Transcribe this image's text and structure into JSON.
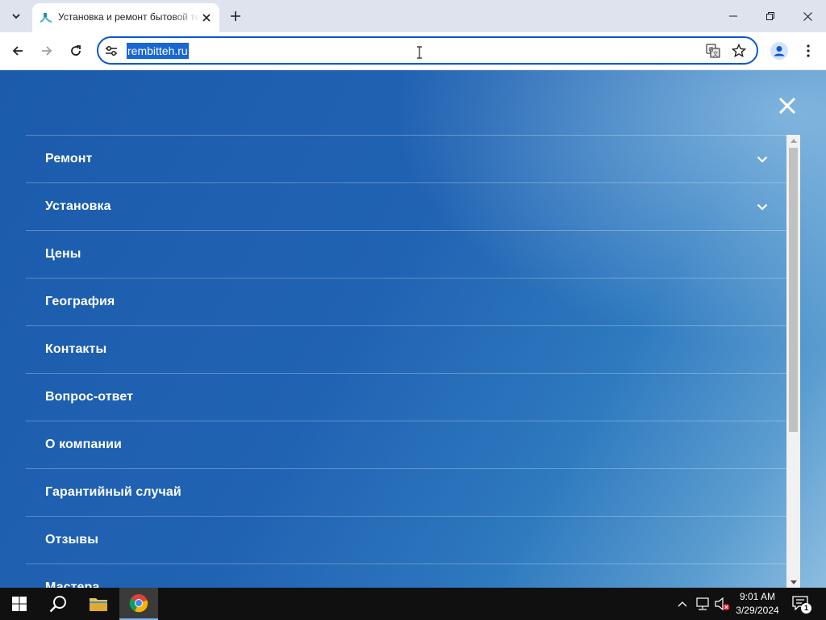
{
  "browser": {
    "tab": {
      "title": "Установка и ремонт бытовой техники"
    },
    "address": {
      "url": "rembitteh.ru"
    }
  },
  "menu": {
    "items": [
      {
        "label": "Ремонт",
        "has_submenu": true
      },
      {
        "label": "Установка",
        "has_submenu": true
      },
      {
        "label": "Цены",
        "has_submenu": false
      },
      {
        "label": "География",
        "has_submenu": false
      },
      {
        "label": "Контакты",
        "has_submenu": false
      },
      {
        "label": "Вопрос-ответ",
        "has_submenu": false
      },
      {
        "label": "О компании",
        "has_submenu": false
      },
      {
        "label": "Гарантийный случай",
        "has_submenu": false
      },
      {
        "label": "Отзывы",
        "has_submenu": false
      },
      {
        "label": "Мастера",
        "has_submenu": false
      }
    ]
  },
  "taskbar": {
    "time": "9:01 AM",
    "date": "3/29/2024",
    "notification_count": "1"
  },
  "colors": {
    "menu_background": "#2163b3",
    "omnibox_focus": "#0b57d0",
    "url_selection": "#1967d2",
    "taskbar": "#101010"
  },
  "icons": {
    "tab_search": "chevron-down-icon",
    "favicon": "favicon",
    "tab_close": "close-icon",
    "new_tab": "plus-icon",
    "back": "arrow-left-icon",
    "forward": "arrow-right-icon",
    "reload": "reload-icon",
    "site_info": "tune-icon",
    "translate": "translate-icon",
    "bookmark": "star-icon",
    "profile": "profile-icon",
    "menu": "kebab-icon",
    "menu_close": "close-icon",
    "submenu": "chevron-down-icon"
  }
}
